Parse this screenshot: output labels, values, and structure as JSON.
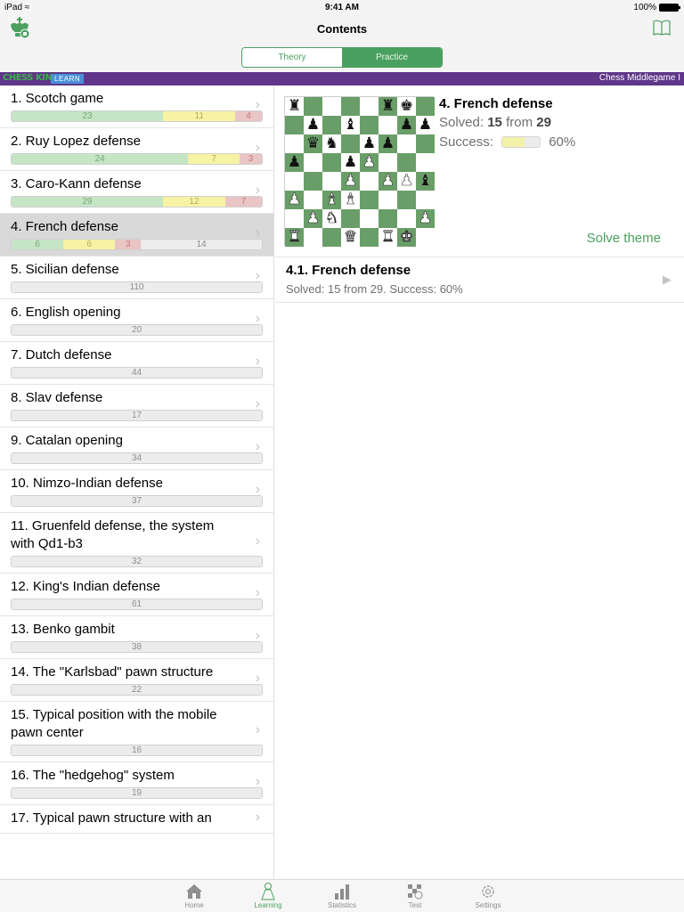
{
  "status": {
    "device": "iPad",
    "wifi_icon": "wifi-icon",
    "time": "9:41 AM",
    "battery": "100%"
  },
  "nav": {
    "title": "Contents",
    "logo_icon": "chess-king-logo-icon",
    "book_icon": "book-icon"
  },
  "segments": [
    {
      "label": "Theory",
      "active": false
    },
    {
      "label": "Practice",
      "active": true
    }
  ],
  "brand": {
    "name": "CHESS KING",
    "tag": "LEARN",
    "course": "Chess Middlegame I"
  },
  "colors": {
    "accent": "#4aa05e",
    "brand_bar": "#5f3689",
    "solved": "#c5e5c5",
    "partial": "#f7f3a4",
    "failed": "#e9c5c5",
    "unsolved": "#ececec"
  },
  "themes": [
    {
      "title": "1. Scotch game",
      "green": 23,
      "yellow": 11,
      "red": 4,
      "gray": 0
    },
    {
      "title": "2. Ruy Lopez defense",
      "green": 24,
      "yellow": 7,
      "red": 3,
      "gray": 0
    },
    {
      "title": "3. Caro-Kann defense",
      "green": 29,
      "yellow": 12,
      "red": 7,
      "gray": 0
    },
    {
      "title": "4. French defense",
      "green": 6,
      "yellow": 6,
      "red": 3,
      "gray": 14,
      "selected": true
    },
    {
      "title": "5. Sicilian defense",
      "gray": 110
    },
    {
      "title": "6. English opening",
      "gray": 20
    },
    {
      "title": "7. Dutch defense",
      "gray": 44
    },
    {
      "title": "8. Slav defense",
      "gray": 17
    },
    {
      "title": "9. Catalan opening",
      "gray": 34
    },
    {
      "title": "10. Nimzo-Indian defense",
      "gray": 37
    },
    {
      "title": "11. Gruenfeld defense, the system with Qd1-b3",
      "gray": 32
    },
    {
      "title": "12. King's Indian defense",
      "gray": 61
    },
    {
      "title": "13. Benko gambit",
      "gray": 38
    },
    {
      "title": "14. The \"Karlsbad\" pawn structure",
      "gray": 22
    },
    {
      "title": "15. Typical position with the mobile pawn center",
      "gray": 16
    },
    {
      "title": "16. The \"hedgehog\" system",
      "gray": 19
    },
    {
      "title": "17. Typical pawn structure with an",
      "gray": null
    }
  ],
  "detail": {
    "title": "4. French defense",
    "solved_label": "Solved:",
    "solved": "15",
    "from_label": "from",
    "total": "29",
    "success_label": "Success:",
    "success_fraction": 0.6,
    "success_text": "60%",
    "solve_button": "Solve theme",
    "board": [
      [
        "r",
        "",
        "",
        "",
        "",
        "r",
        "k",
        ""
      ],
      [
        "",
        "p",
        "",
        "b",
        "",
        "",
        "p",
        "p"
      ],
      [
        "",
        "q",
        "n",
        "",
        "p",
        "p",
        "",
        ""
      ],
      [
        "p",
        "",
        "",
        "p",
        "P",
        "",
        "",
        ""
      ],
      [
        "",
        "",
        "",
        "P",
        "",
        "P",
        "P",
        "b"
      ],
      [
        "P",
        "",
        "B",
        "B",
        "",
        "",
        "",
        ""
      ],
      [
        "",
        "P",
        "N",
        "",
        "",
        "",
        "",
        "P"
      ],
      [
        "R",
        "",
        "",
        "Q",
        "",
        "R",
        "K",
        ""
      ]
    ]
  },
  "subtheme": {
    "title": "4.1. French defense",
    "desc": "Solved: 15 from 29. Success: 60%"
  },
  "tabs": [
    {
      "label": "Home",
      "icon": "home-icon"
    },
    {
      "label": "Learning",
      "icon": "learning-pawn-icon",
      "active": true
    },
    {
      "label": "Statistics",
      "icon": "statistics-icon"
    },
    {
      "label": "Test",
      "icon": "test-icon"
    },
    {
      "label": "Settings",
      "icon": "settings-icon"
    }
  ]
}
